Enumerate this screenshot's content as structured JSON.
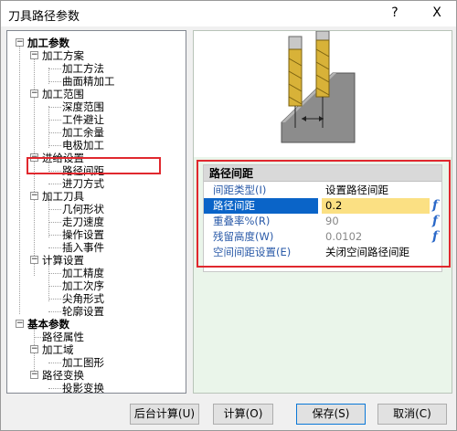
{
  "window": {
    "title": "刀具路径参数",
    "help_label": "?",
    "close_label": "X"
  },
  "tree": {
    "machining_params": "加工参数",
    "machining_scheme": "加工方案",
    "machining_method": "加工方法",
    "curved_finishing": "曲面精加工",
    "machining_range": "加工范围",
    "depth_range": "深度范围",
    "workpiece_avoidance": "工件避让",
    "machining_allowance": "加工余量",
    "electrode_machining": "电极加工",
    "feed_settings": "进给设置",
    "path_spacing": "路径间距",
    "feed_mode": "进刀方式",
    "machining_tool": "加工刀具",
    "geometry": "几何形状",
    "feed_speed": "走刀速度",
    "operation_settings": "操作设置",
    "insert_event": "插入事件",
    "calc_settings": "计算设置",
    "machining_precision": "加工精度",
    "machining_order": "加工次序",
    "corner_form": "尖角形式",
    "contour_settings": "轮廓设置",
    "basic_params": "基本参数",
    "path_attributes": "路径属性",
    "machining_domain": "加工域",
    "machining_graphics": "加工图形",
    "path_transform": "路径变换",
    "projection_transform": "投影变换"
  },
  "params": {
    "header": "路径间距",
    "rows": [
      {
        "name": "间距类型(I)",
        "value": "设置路径间距",
        "f": ""
      },
      {
        "name": "路径间距",
        "value": "0.2",
        "f": "f"
      },
      {
        "name": "重叠率%(R)",
        "value": "90",
        "f": "f"
      },
      {
        "name": "残留高度(W)",
        "value": "0.0102",
        "f": "f"
      },
      {
        "name": "空间间距设置(E)",
        "value": "关闭空间路径间距",
        "f": ""
      }
    ]
  },
  "buttons": {
    "background_calc": "后台计算(U)",
    "calc": "计算(O)",
    "save": "保存(S)",
    "cancel": "取消(C)"
  },
  "colors": {
    "highlight_box": "#e0282e",
    "selected_row": "#0a64c8",
    "selected_value": "#fbe083",
    "param_label": "#2a5aa8"
  }
}
